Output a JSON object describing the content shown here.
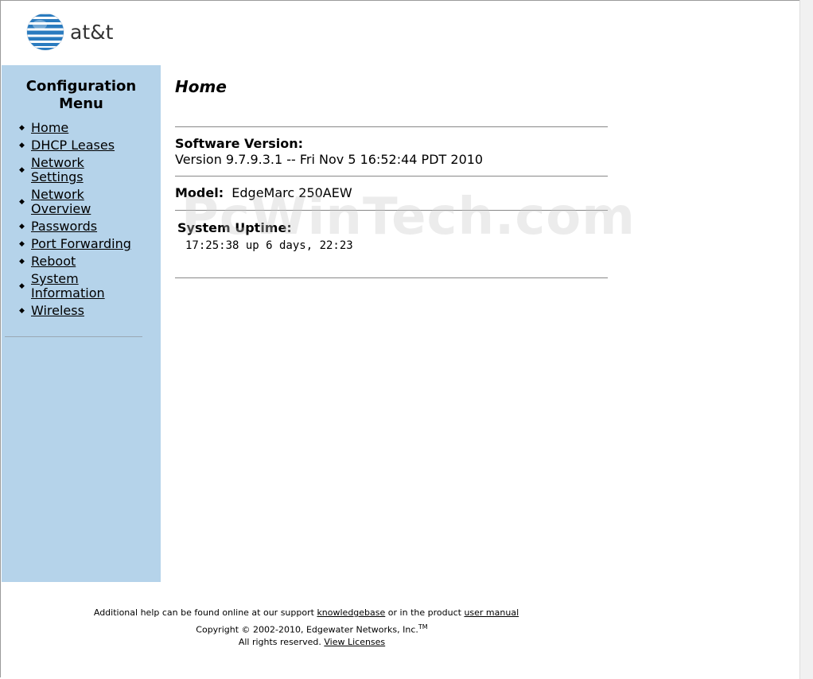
{
  "logo": {
    "text": "at&t"
  },
  "sidebar": {
    "title_line1": "Configuration",
    "title_line2": "Menu",
    "items": [
      {
        "label": "Home"
      },
      {
        "label": "DHCP Leases"
      },
      {
        "label": "Network Settings"
      },
      {
        "label": "Network Overview"
      },
      {
        "label": "Passwords"
      },
      {
        "label": "Port Forwarding"
      },
      {
        "label": "Reboot"
      },
      {
        "label": "System Information"
      },
      {
        "label": "Wireless"
      }
    ]
  },
  "main": {
    "title": "Home",
    "software_label": "Software Version:",
    "software_value": "Version 9.7.9.3.1 -- Fri Nov 5 16:52:44 PDT 2010",
    "model_label": "Model:",
    "model_value": "EdgeMarc 250AEW",
    "uptime_label": "System Uptime:",
    "uptime_value": "17:25:38 up 6 days, 22:23"
  },
  "watermark": "PcWinTech.com",
  "footer": {
    "help_prefix": "Additional help can be found online at our support",
    "knowledgebase_link": "knowledgebase",
    "help_middle": "or in the product",
    "manual_link": "user manual",
    "copyright": "Copyright © 2002-2010, Edgewater Networks, Inc.",
    "tm": "TM",
    "rights": "All rights reserved.",
    "licenses_link": "View Licenses"
  },
  "colors": {
    "sidebar_bg": "#b5d3ea",
    "globe_blue": "#2a7bbf"
  }
}
